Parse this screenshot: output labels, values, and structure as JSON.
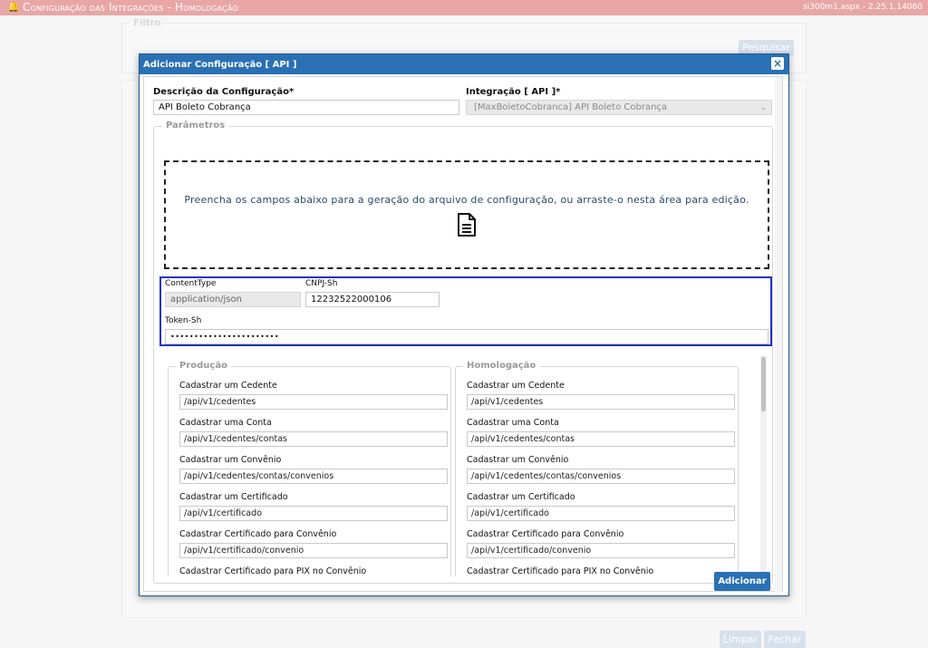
{
  "topbar": {
    "title": "Configuração das Integrações  - Homologação",
    "version": "si300m1.aspx - 2.25.1.14060"
  },
  "background": {
    "filter_legend": "Filtro",
    "search_button": "Pesquisar",
    "clear_button": "Limpar",
    "close_button": "Fechar"
  },
  "modal": {
    "title": "Adicionar Configuração [ API ]",
    "close_label": "×",
    "description_label": "Descrição da Configuração*",
    "description_value": "API Boleto Cobrança",
    "integration_label": "Integração [ API ]*",
    "integration_value": "[MaxBoletoCobranca] API Boleto Cobrança",
    "params_legend": "Parâmetros",
    "dropzone_text": "Preencha os campos abaixo para a geração do arquivo de configuração, ou arraste-o nesta área para edição.",
    "content_type_label": "ContentType",
    "content_type_value": "application/json",
    "cnpj_label": "CNPJ-Sh",
    "cnpj_value": "12232522000106",
    "token_label": "Token-Sh",
    "token_value": "•••••••••••••••••••••••",
    "add_button": "Adicionar"
  },
  "endpoints": {
    "producao": {
      "legend": "Produção",
      "items": [
        {
          "label": "Cadastrar um Cedente",
          "value": "/api/v1/cedentes"
        },
        {
          "label": "Cadastrar uma Conta",
          "value": "/api/v1/cedentes/contas"
        },
        {
          "label": "Cadastrar um Convênio",
          "value": "/api/v1/cedentes/contas/convenios"
        },
        {
          "label": "Cadastrar um Certificado",
          "value": "/api/v1/certificado"
        },
        {
          "label": "Cadastrar Certificado para Convênio",
          "value": "/api/v1/certificado/convenio"
        },
        {
          "label": "Cadastrar Certificado para PIX no Convênio",
          "value": ""
        }
      ]
    },
    "homologacao": {
      "legend": "Homologação",
      "items": [
        {
          "label": "Cadastrar um Cedente",
          "value": "/api/v1/cedentes"
        },
        {
          "label": "Cadastrar uma Conta",
          "value": "/api/v1/cedentes/contas"
        },
        {
          "label": "Cadastrar um Convênio",
          "value": "/api/v1/cedentes/contas/convenios"
        },
        {
          "label": "Cadastrar um Certificado",
          "value": "/api/v1/certificado"
        },
        {
          "label": "Cadastrar Certificado para Convênio",
          "value": "/api/v1/certificado/convenio"
        },
        {
          "label": "Cadastrar Certificado para PIX no Convênio",
          "value": ""
        }
      ]
    }
  },
  "icons": {
    "bell": "bell-icon",
    "close": "close-icon",
    "document": "document-icon",
    "select": "chevron-down-icon"
  }
}
